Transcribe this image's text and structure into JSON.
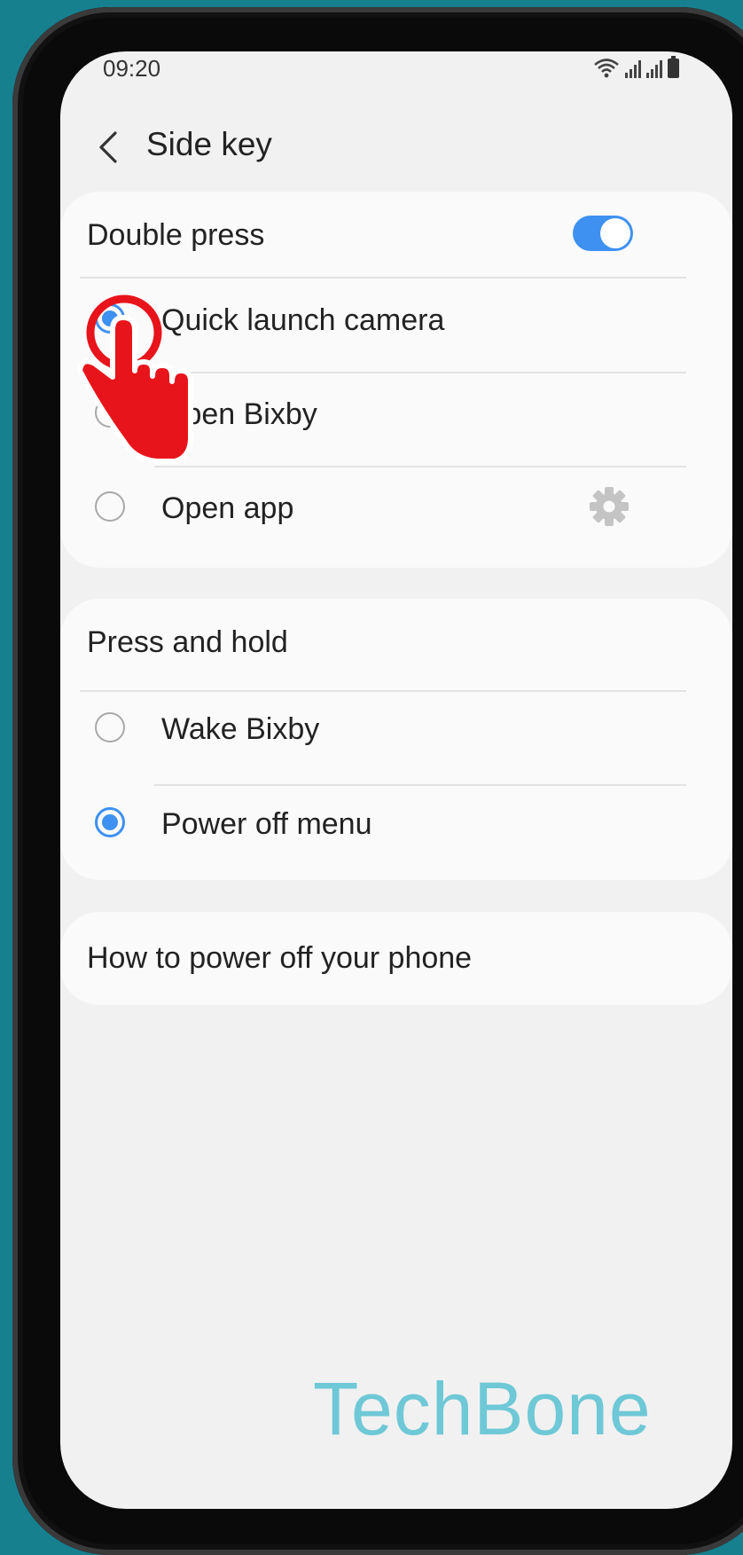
{
  "status_bar": {
    "time": "09:20"
  },
  "header": {
    "title": "Side key"
  },
  "double_press": {
    "label": "Double press",
    "enabled": true,
    "options": [
      {
        "label": "Quick launch camera",
        "selected": true
      },
      {
        "label": "Open Bixby",
        "selected": false
      },
      {
        "label": "Open app",
        "selected": false
      }
    ]
  },
  "press_and_hold": {
    "label": "Press and hold",
    "options": [
      {
        "label": "Wake Bixby",
        "selected": false
      },
      {
        "label": "Power off menu",
        "selected": true
      }
    ]
  },
  "help_link": {
    "label": "How to power off your phone"
  },
  "watermark": {
    "text": "TechBone"
  },
  "colors": {
    "accent": "#3e91f0",
    "background": "#17808f",
    "overlay": "#e8141b"
  },
  "icons": [
    "back-arrow-icon",
    "wifi-icon",
    "signal-icon",
    "battery-icon",
    "gear-icon",
    "tap-hand-icon"
  ]
}
